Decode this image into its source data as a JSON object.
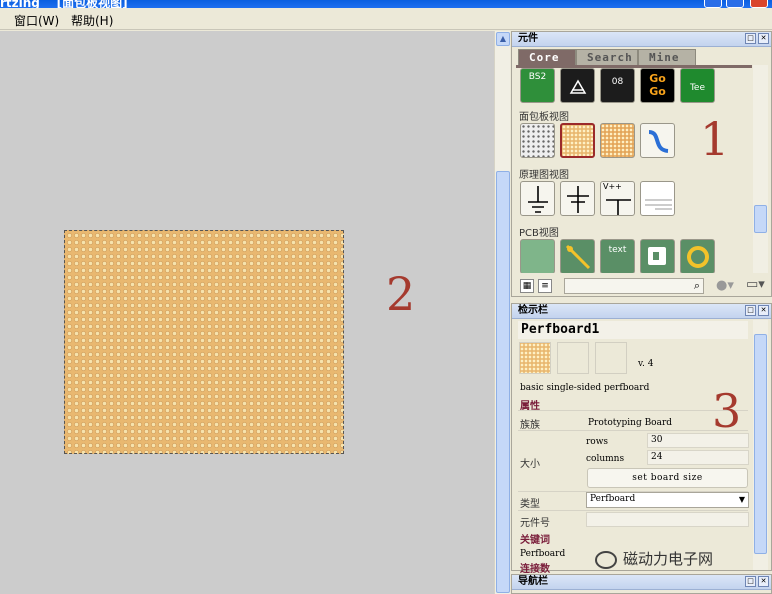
{
  "window": {
    "title": "rtzing    [面包板视图]"
  },
  "menu": {
    "items": [
      "窗口(W)",
      "帮助(H)"
    ]
  },
  "canvas": {
    "annotation": "2"
  },
  "parts_bin": {
    "title": "元件",
    "tabs": [
      "Core",
      "Search",
      "Mine"
    ],
    "core_items": [
      "BS2",
      "",
      "08",
      "Go Go",
      "Tee"
    ],
    "sections": [
      "面包板视图",
      "原理图视图",
      "PCB视图"
    ],
    "schematic_items": [
      "",
      "",
      "V++",
      ""
    ],
    "pcb_items": [
      "",
      "",
      "text",
      "",
      ""
    ],
    "annotation": "1"
  },
  "inspector": {
    "title": "检示栏",
    "part_title": "Perfboard1",
    "version": "v. 4",
    "description": "basic single-sided perfboard",
    "properties_label": "属性",
    "family_label": "族族",
    "family_value": "Prototyping Board",
    "size_label": "大小",
    "rows_label": "rows",
    "rows_value": "30",
    "columns_label": "columns",
    "columns_value": "24",
    "set_size_button": "set board size",
    "type_label": "类型",
    "type_value": "Perfboard",
    "partno_label": "元件号",
    "tags_label": "关键词",
    "tag_value": "Perfboard",
    "connections_label": "连接数",
    "annotation": "3"
  },
  "navigator": {
    "title": "导航栏"
  },
  "watermark": "磁动力电子网"
}
